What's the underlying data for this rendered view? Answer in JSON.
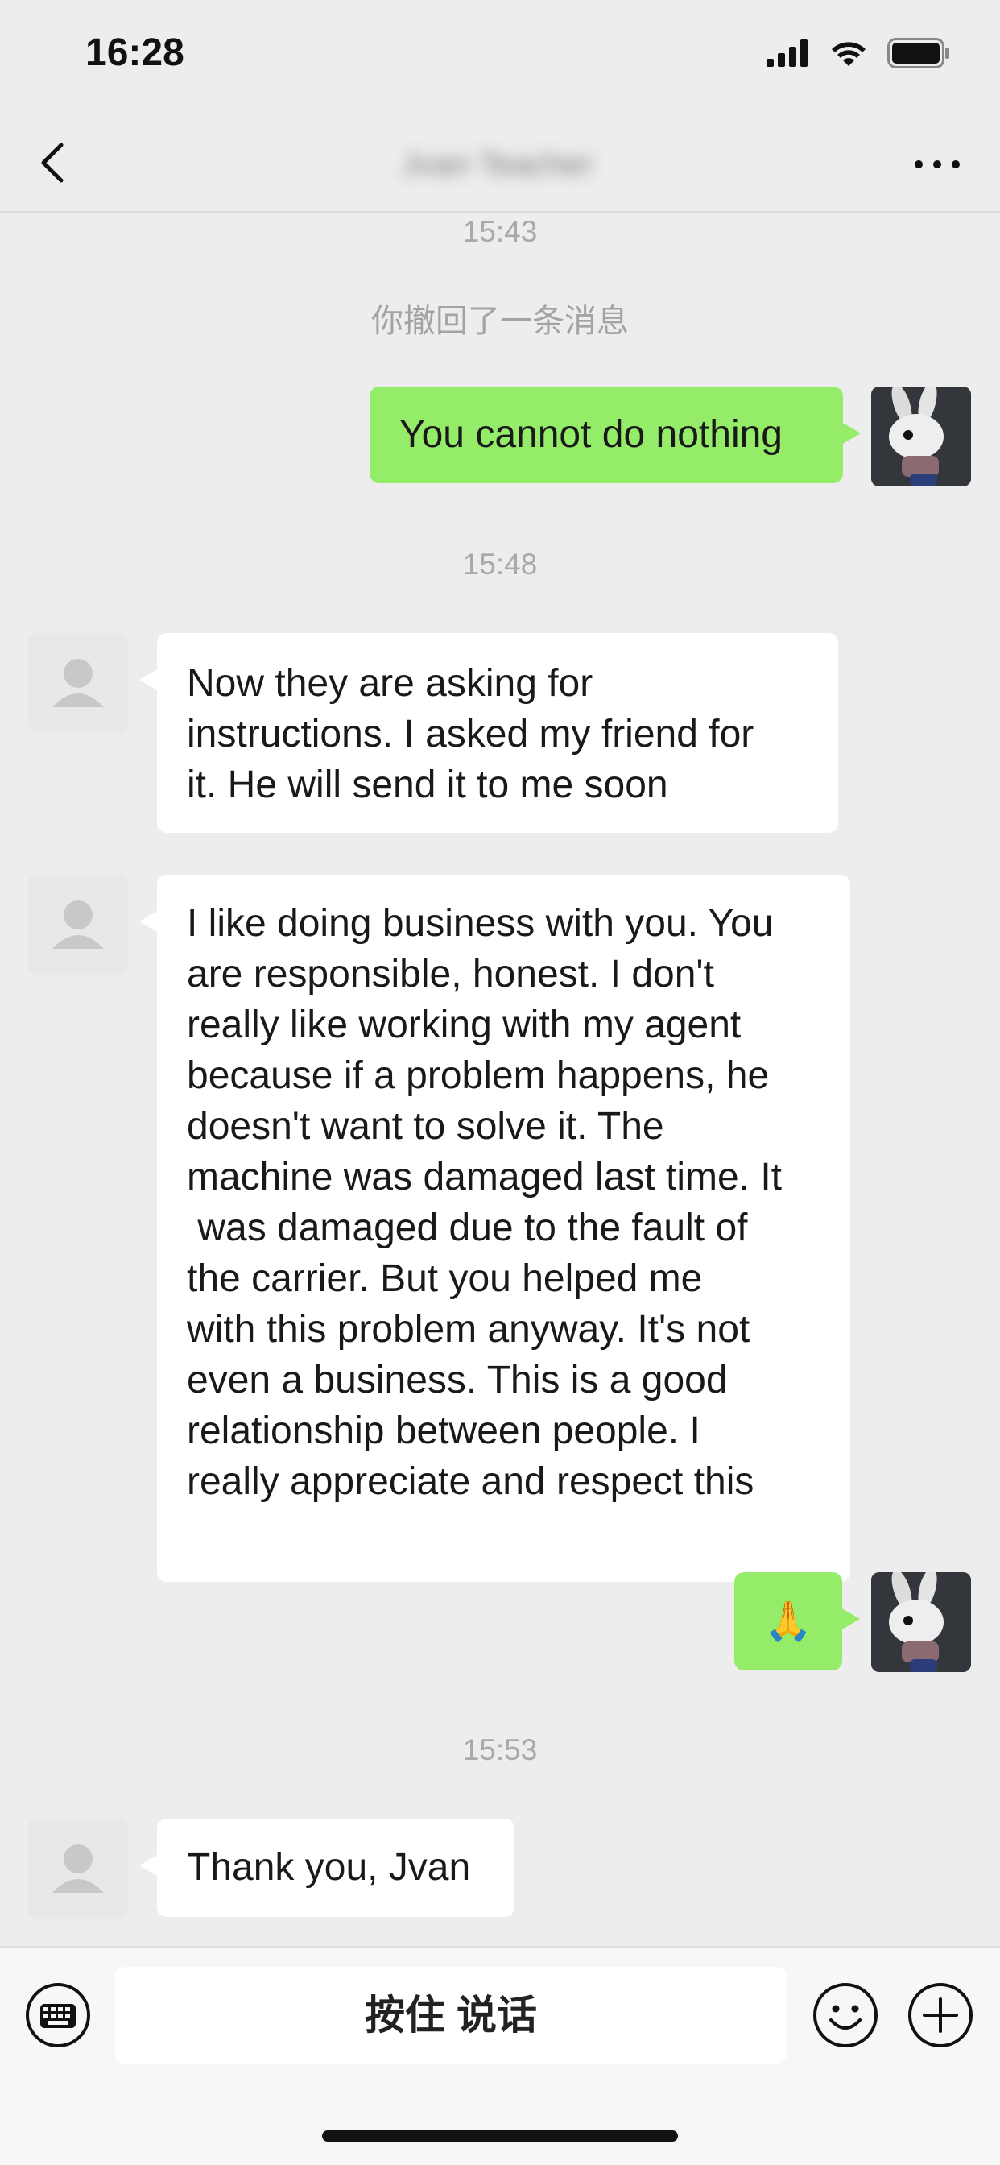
{
  "status_bar": {
    "time": "16:28"
  },
  "nav": {
    "title": "Jvan Teacher",
    "back_icon": "chevron-left-icon",
    "more_icon": "more-dots-icon"
  },
  "chat": {
    "timestamps": [
      "15:43",
      "15:48",
      "15:53"
    ],
    "recalled_notice": "你撤回了一条消息",
    "messages": [
      {
        "sender": "me",
        "text": "You cannot do nothing"
      },
      {
        "sender": "contact",
        "lines": [
          "Now they are asking for",
          "instructions. I asked my friend for",
          "it. He will send it to me soon"
        ]
      },
      {
        "sender": "contact",
        "lines": [
          "I like doing business with you. You",
          "are responsible, honest. I don't",
          "really like working with my agent",
          "because if a problem happens, he",
          "doesn't want to solve it. The",
          "machine was damaged last time. It",
          " was damaged due to the fault of",
          "the carrier. But you helped me",
          "with this problem anyway. It's not",
          "even a business. This is a good",
          "relationship between people. I",
          "really appreciate and respect this"
        ]
      },
      {
        "sender": "me",
        "text": "🙏"
      },
      {
        "sender": "contact",
        "text": "Thank you, Jvan"
      }
    ]
  },
  "input_bar": {
    "hold_to_talk": "按住 说话",
    "keyboard_icon": "keyboard-icon",
    "emoji_icon": "emoji-icon",
    "add_icon": "plus-icon"
  },
  "colors": {
    "sent_bubble": "#95ec69",
    "received_bubble": "#ffffff",
    "background": "#ededed"
  }
}
